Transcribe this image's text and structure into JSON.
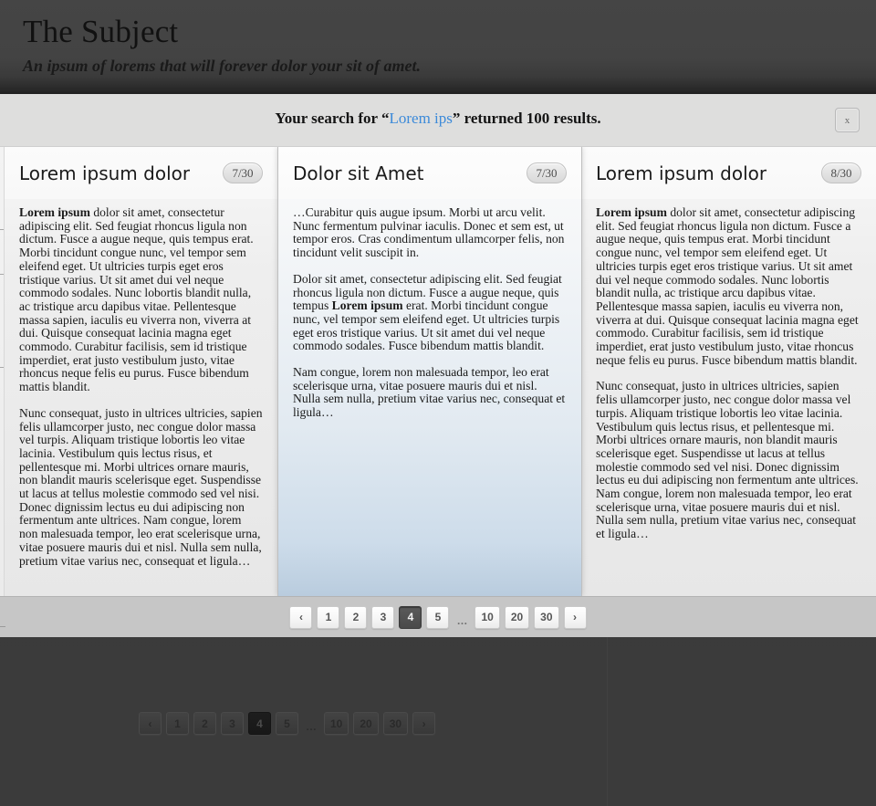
{
  "site": {
    "title": "The Subject",
    "tagline": "An ipsum of lorems that will forever dolor your sit of amet."
  },
  "overlay": {
    "search_prefix": "Your search for “",
    "search_query": "Lorem ips",
    "search_suffix": "” returned 100 results.",
    "close_label": "x"
  },
  "cards": [
    {
      "title": "Lorem ipsum dolor",
      "badge": "7/30",
      "lead": "Lorem ipsum",
      "p1_rest": " dolor sit amet, consectetur adipiscing elit. Sed feugiat rhoncus ligula non dictum. Fusce a augue neque, quis tempus erat. Morbi tincidunt congue nunc, vel tempor sem eleifend eget. Ut ultricies turpis eget eros tristique varius. Ut sit amet dui vel neque commodo sodales. Nunc lobortis blandit nulla, ac tristique arcu dapibus vitae. Pellentesque massa sapien, iaculis eu viverra non, viverra at dui. Quisque consequat lacinia magna eget commodo. Curabitur facilisis, sem id tristique imperdiet, erat justo vestibulum justo, vitae rhoncus neque felis eu purus. Fusce bibendum mattis blandit.",
      "p2": "Nunc consequat, justo in ultrices ultricies, sapien felis ullamcorper justo, nec congue dolor massa vel turpis. Aliquam tristique lobortis leo vitae lacinia. Vestibulum quis lectus risus, et pellentesque mi. Morbi ultrices ornare mauris, non blandit mauris scelerisque eget. Suspendisse ut lacus at tellus molestie commodo sed vel nisi. Donec dignissim lectus eu dui adipiscing non fermentum ante ultrices. Nam congue, lorem non malesuada tempor, leo erat scelerisque urna, vitae posuere mauris dui et nisl. Nulla sem nulla, pretium vitae varius nec, consequat et ligula…"
    },
    {
      "title": "Dolor sit Amet",
      "badge": "7/30",
      "p1": "…Curabitur quis augue ipsum. Morbi ut arcu velit. Nunc fermentum pulvinar iaculis. Donec et sem est, ut tempor eros. Cras condimentum ullamcorper felis, non tincidunt velit suscipit in.",
      "p2_before": "Dolor sit amet, consectetur adipiscing elit. Sed feugiat rhoncus ligula non dictum. Fusce a augue neque, quis tempus ",
      "p2_bold": "Lorem ipsum",
      "p2_after": " erat. Morbi tincidunt congue nunc, vel tempor sem eleifend eget. Ut ultricies turpis eget eros tristique varius. Ut sit amet dui vel neque commodo sodales. Fusce bibendum mattis blandit.",
      "p3": " Nam congue, lorem non malesuada tempor, leo erat scelerisque urna, vitae posuere mauris dui et nisl. Nulla sem nulla, pretium vitae varius nec, consequat et ligula…"
    },
    {
      "title": "Lorem ipsum dolor",
      "badge": "8/30",
      "lead": "Lorem ipsum",
      "p1_rest": " dolor sit amet, consectetur adipiscing elit. Sed feugiat rhoncus ligula non dictum. Fusce a augue neque, quis tempus erat. Morbi tincidunt congue nunc, vel tempor sem eleifend eget. Ut ultricies turpis eget eros tristique varius. Ut sit amet dui vel neque commodo sodales. Nunc lobortis blandit nulla, ac tristique arcu dapibus vitae. Pellentesque massa sapien, iaculis eu viverra non, viverra at dui. Quisque consequat lacinia magna eget commodo. Curabitur facilisis, sem id tristique imperdiet, erat justo vestibulum justo, vitae rhoncus neque felis eu purus. Fusce bibendum mattis blandit.",
      "p2": "Nunc consequat, justo in ultrices ultricies, sapien felis ullamcorper justo, nec congue dolor massa vel turpis. Aliquam tristique lobortis leo vitae lacinia. Vestibulum quis lectus risus, et pellentesque mi. Morbi ultrices ornare mauris, non blandit mauris scelerisque eget. Suspendisse ut lacus at tellus molestie commodo sed vel nisi. Donec dignissim lectus eu dui adipiscing non fermentum ante ultrices. Nam congue, lorem non malesuada tempor, leo erat scelerisque urna, vitae posuere mauris dui et nisl. Nulla sem nulla, pretium vitae varius nec, consequat et ligula…"
    }
  ],
  "pagination": {
    "prev_icon": "‹",
    "next_icon": "›",
    "ellipsis": "…",
    "current_page": "4",
    "pages_before": [
      "1",
      "2",
      "3"
    ],
    "pages_after": [
      "5"
    ],
    "pages_jump": [
      "10",
      "20",
      "30"
    ]
  },
  "colors": {
    "accent_link": "#3c8ad9",
    "header_dark": "#434343",
    "overlay_bar": "#dededd",
    "featured_card_bottom": "#b9ccde",
    "active_page_light": "#4a4a4a"
  }
}
